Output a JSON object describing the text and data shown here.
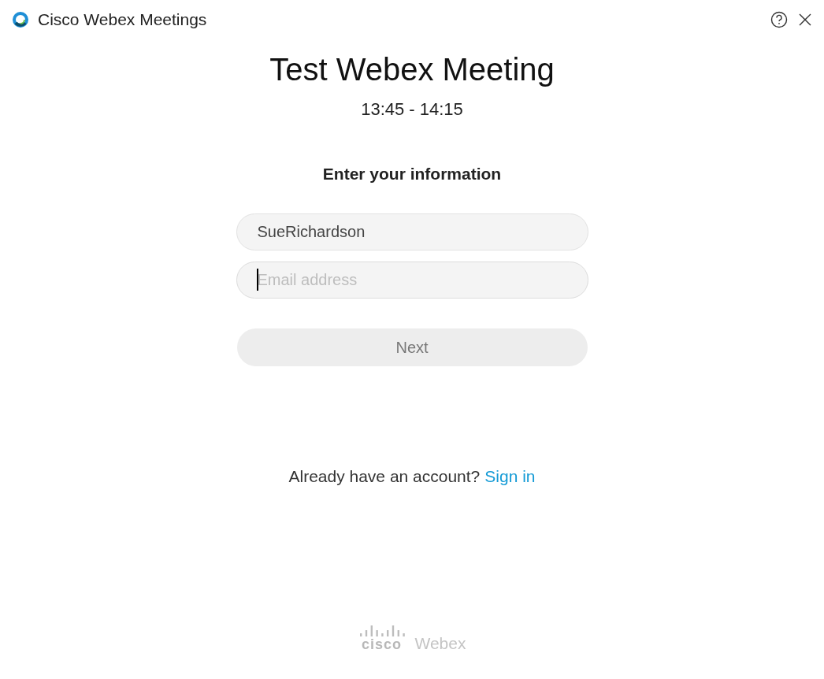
{
  "window": {
    "title": "Cisco Webex Meetings"
  },
  "meeting": {
    "title": "Test Webex Meeting",
    "time": "13:45 - 14:15"
  },
  "form": {
    "heading": "Enter your information",
    "fields": [
      {
        "value": "SueRichardson",
        "focused": false
      },
      {
        "placeholder": "Email address",
        "focused": true
      }
    ],
    "next_button": {
      "label": "Next",
      "disabled": true
    }
  },
  "sign_in": {
    "prompt": "Already have an account?",
    "link": "Sign in"
  },
  "footer_logo": {
    "brand": "cisco",
    "product": "Webex"
  }
}
